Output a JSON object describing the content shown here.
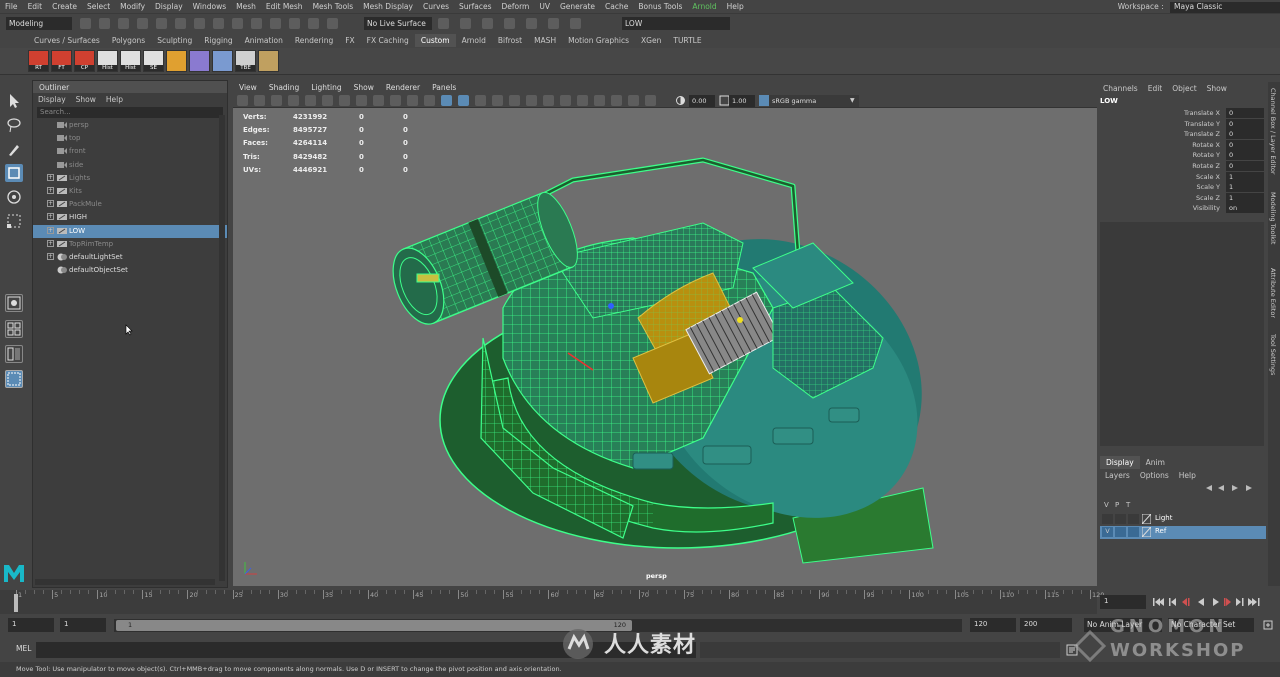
{
  "menubar": {
    "items": [
      "File",
      "Edit",
      "Create",
      "Select",
      "Modify",
      "Display",
      "Windows",
      "Mesh",
      "Edit Mesh",
      "Mesh Tools",
      "Mesh Display",
      "Curves",
      "Surfaces",
      "Deform",
      "UV",
      "Generate",
      "Cache",
      "Bonus Tools"
    ],
    "arnold": "Arnold",
    "help": "Help",
    "workspace_label": "Workspace :",
    "workspace_value": "Maya Classic"
  },
  "statusline": {
    "mode": "Modeling",
    "live_surface": "No Live Surface",
    "object_field": "LOW"
  },
  "shelf": {
    "tabs": [
      "Curves / Surfaces",
      "Polygons",
      "Sculpting",
      "Rigging",
      "Animation",
      "Rendering",
      "FX",
      "FX Caching",
      "Custom",
      "Arnold",
      "Bifrost",
      "MASH",
      "Motion Graphics",
      "XGen",
      "TURTLE"
    ],
    "active_tab": "Custom",
    "buttons": [
      "RT",
      "FT",
      "CP",
      "Hist",
      "Hist",
      "SE",
      "",
      "",
      "",
      "TBE",
      ""
    ]
  },
  "outliner": {
    "title": "Outliner",
    "menu": [
      "Display",
      "Show",
      "Help"
    ],
    "search_placeholder": "Search...",
    "items": [
      {
        "label": "persp",
        "dim": true,
        "expand": false,
        "type": "camera"
      },
      {
        "label": "top",
        "dim": true,
        "expand": false,
        "type": "camera"
      },
      {
        "label": "front",
        "dim": true,
        "expand": false,
        "type": "camera"
      },
      {
        "label": "side",
        "dim": true,
        "expand": false,
        "type": "camera"
      },
      {
        "label": "Lights",
        "dim": true,
        "expand": true,
        "type": "group"
      },
      {
        "label": "Kits",
        "dim": true,
        "expand": true,
        "type": "group"
      },
      {
        "label": "PackMule",
        "dim": true,
        "expand": true,
        "type": "group"
      },
      {
        "label": "HIGH",
        "dim": false,
        "expand": true,
        "type": "group"
      },
      {
        "label": "LOW",
        "dim": false,
        "expand": true,
        "type": "group",
        "selected": true
      },
      {
        "label": "TopRimTemp",
        "dim": true,
        "expand": true,
        "type": "group"
      },
      {
        "label": "defaultLightSet",
        "dim": false,
        "expand": true,
        "type": "set"
      },
      {
        "label": "defaultObjectSet",
        "dim": false,
        "expand": false,
        "type": "set"
      }
    ]
  },
  "viewport": {
    "menu": [
      "View",
      "Shading",
      "Lighting",
      "Show",
      "Renderer",
      "Panels"
    ],
    "exposure": "0.00",
    "gamma": "1.00",
    "colorspace": "sRGB gamma",
    "camera_label": "persp",
    "hud": [
      {
        "label": "Verts:",
        "v1": "4231992",
        "v2": "0",
        "v3": "0"
      },
      {
        "label": "Edges:",
        "v1": "8495727",
        "v2": "0",
        "v3": "0"
      },
      {
        "label": "Faces:",
        "v1": "4264114",
        "v2": "0",
        "v3": "0"
      },
      {
        "label": "Tris:",
        "v1": "8429482",
        "v2": "0",
        "v3": "0"
      },
      {
        "label": "UVs:",
        "v1": "4446921",
        "v2": "0",
        "v3": "0"
      }
    ]
  },
  "channelbox": {
    "menu": [
      "Channels",
      "Edit",
      "Object",
      "Show"
    ],
    "object": "LOW",
    "channels": [
      {
        "name": "Translate X",
        "value": "0"
      },
      {
        "name": "Translate Y",
        "value": "0"
      },
      {
        "name": "Translate Z",
        "value": "0"
      },
      {
        "name": "Rotate X",
        "value": "0"
      },
      {
        "name": "Rotate Y",
        "value": "0"
      },
      {
        "name": "Rotate Z",
        "value": "0"
      },
      {
        "name": "Scale X",
        "value": "1"
      },
      {
        "name": "Scale Y",
        "value": "1"
      },
      {
        "name": "Scale Z",
        "value": "1"
      },
      {
        "name": "Visibility",
        "value": "on"
      }
    ]
  },
  "layers": {
    "tabs": [
      "Display",
      "Anim"
    ],
    "menu": [
      "Layers",
      "Options",
      "Help"
    ],
    "columns": [
      "V",
      "P",
      "T"
    ],
    "rows": [
      {
        "name": "Light",
        "v": "",
        "selected": false
      },
      {
        "name": "Ref",
        "v": "V",
        "selected": true
      }
    ]
  },
  "sidetabs": [
    "Channel Box / Layer Editor",
    "Modeling Toolkit",
    "Attribute Editor",
    "Tool Settings"
  ],
  "timeline": {
    "ticks": [
      "1",
      "5",
      "10",
      "15",
      "20",
      "25",
      "30",
      "35",
      "40",
      "45",
      "50",
      "55",
      "60",
      "65",
      "70",
      "75",
      "80",
      "85",
      "90",
      "95",
      "100",
      "105",
      "110",
      "115",
      "120"
    ],
    "current_frame": "1",
    "range_start": "1",
    "range_start_inner": "1",
    "range_slider_start": "1",
    "range_slider_end": "120",
    "range_end_inner": "120",
    "range_end": "200",
    "anim_layer": "No Anim Layer",
    "character_set": "No Character Set"
  },
  "cmdline": {
    "label": "MEL"
  },
  "helpline": {
    "text": "Move Tool: Use manipulator to move object(s). Ctrl+MMB+drag to move components along normals. Use D or INSERT to change the pivot position and axis orientation."
  },
  "watermark": {
    "text": "人人素材",
    "brand_line1": "GNOMON",
    "brand_line2": "WORKSHOP"
  },
  "colors": {
    "wire": "#3dff8a",
    "model": "#2b8a80",
    "selection": "#5b8bb5",
    "highlight_orange": "#c8a018"
  }
}
